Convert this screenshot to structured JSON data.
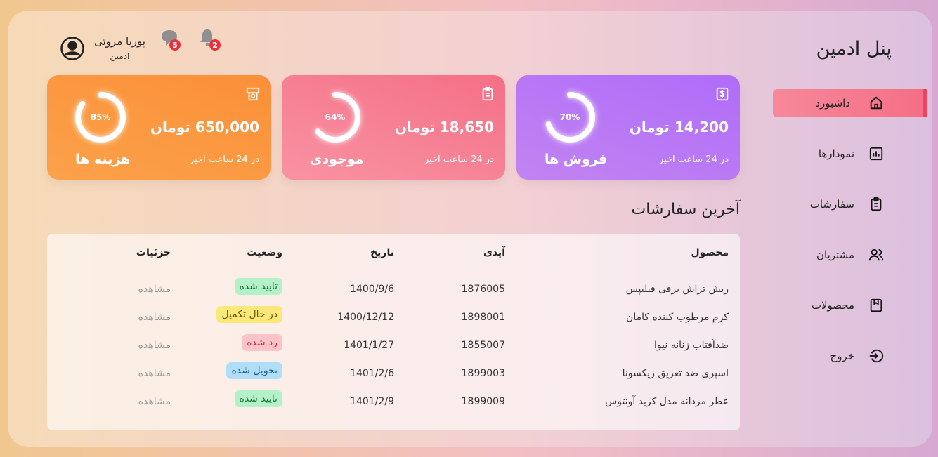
{
  "brand": {
    "title": "پنل ادمین"
  },
  "menu": [
    {
      "label": "داشبورد",
      "icon": "home-icon",
      "active": true
    },
    {
      "label": "نمودارها",
      "icon": "chart-icon"
    },
    {
      "label": "سفارشات",
      "icon": "clipboard-icon"
    },
    {
      "label": "مشتریان",
      "icon": "users-icon"
    },
    {
      "label": "محصولات",
      "icon": "box-icon"
    },
    {
      "label": "خروج",
      "icon": "logout-icon"
    }
  ],
  "header": {
    "user_name": "پوریا مروتی",
    "user_role": "ادمین",
    "messages_count": "5",
    "notifications_count": "2"
  },
  "cards": [
    {
      "title": "فروش ها",
      "amount": "14,200 تومان",
      "period": "در 24 ساعت اخیر",
      "percent_label": "70%",
      "percent": 70,
      "icon": "dollar-icon"
    },
    {
      "title": "موجودی",
      "amount": "18,650 تومان",
      "period": "در 24 ساعت اخیر",
      "percent_label": "64%",
      "percent": 64,
      "icon": "clipboard-icon"
    },
    {
      "title": "هزینه ها",
      "amount": "650,000 تومان",
      "period": "در 24 ساعت اخیر",
      "percent_label": "85%",
      "percent": 85,
      "icon": "receipt-icon"
    }
  ],
  "orders": {
    "title": "آخرین سفارشات",
    "headers": {
      "product": "محصول",
      "id": "آیدی",
      "date": "تاریخ",
      "status": "وضعیت",
      "details": "جزئیات"
    },
    "rows": [
      {
        "product": "ریش تراش برقی فیلیپس",
        "id": "1876005",
        "date": "1400/9/6",
        "status": "تایید شده",
        "details": "مشاهده"
      },
      {
        "product": "کرم مرطوب کننده کامان",
        "id": "1898001",
        "date": "1400/12/12",
        "status": "در حال تکمیل",
        "details": "مشاهده"
      },
      {
        "product": "ضدآفتاب زنانه نیوا",
        "id": "1855007",
        "date": "1401/1/27",
        "status": "رد شده",
        "details": "مشاهده"
      },
      {
        "product": "اسپری ضد تعریق ریکسونا",
        "id": "1899003",
        "date": "1401/2/6",
        "status": "تحویل شده",
        "details": "مشاهده"
      },
      {
        "product": "عطر مردانه مدل کرید آونتوس",
        "id": "1899009",
        "date": "1401/2/9",
        "status": "تایید شده",
        "details": "مشاهده"
      }
    ]
  }
}
